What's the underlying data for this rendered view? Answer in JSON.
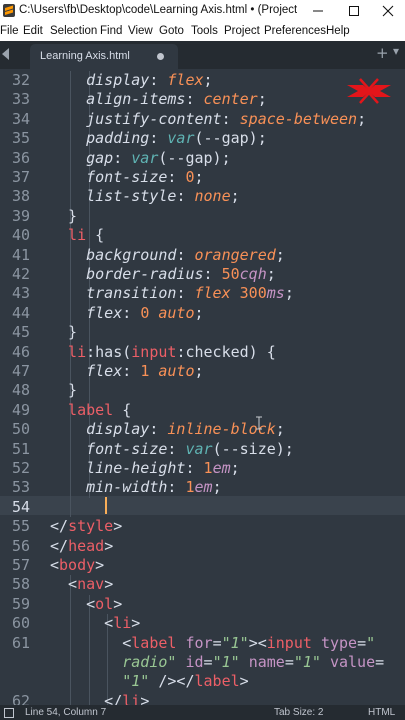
{
  "window": {
    "title": "C:\\Users\\fb\\Desktop\\code\\Learning Axis.html • (Project) - Su…",
    "controls": {
      "minimize": "minimize-icon",
      "maximize": "maximize-icon",
      "close": "close-icon"
    }
  },
  "menu": [
    "File",
    "Edit",
    "Selection",
    "Find",
    "View",
    "Goto",
    "Tools",
    "Project",
    "Preferences",
    "Help"
  ],
  "tabs": [
    {
      "label": "Learning Axis.html",
      "modified": true,
      "active": true
    }
  ],
  "editor": {
    "cursor_line": 54,
    "lines": [
      {
        "n": "32",
        "tokens": [
          {
            "t": "    display",
            "c": "prop"
          },
          {
            "t": ": ",
            "c": "pun"
          },
          {
            "t": "flex",
            "c": "val"
          },
          {
            "t": ";",
            "c": "pun"
          }
        ]
      },
      {
        "n": "33",
        "tokens": [
          {
            "t": "    align-items",
            "c": "prop"
          },
          {
            "t": ": ",
            "c": "pun"
          },
          {
            "t": "center",
            "c": "val"
          },
          {
            "t": ";",
            "c": "pun"
          }
        ]
      },
      {
        "n": "34",
        "tokens": [
          {
            "t": "    justify-content",
            "c": "prop"
          },
          {
            "t": ": ",
            "c": "pun"
          },
          {
            "t": "space-between",
            "c": "val"
          },
          {
            "t": ";",
            "c": "pun"
          }
        ]
      },
      {
        "n": "35",
        "tokens": [
          {
            "t": "    padding",
            "c": "prop"
          },
          {
            "t": ": ",
            "c": "pun"
          },
          {
            "t": "var",
            "c": "fn"
          },
          {
            "t": "(--gap);",
            "c": "pun"
          }
        ]
      },
      {
        "n": "36",
        "tokens": [
          {
            "t": "    gap",
            "c": "prop"
          },
          {
            "t": ": ",
            "c": "pun"
          },
          {
            "t": "var",
            "c": "fn"
          },
          {
            "t": "(--gap);",
            "c": "pun"
          }
        ]
      },
      {
        "n": "37",
        "tokens": [
          {
            "t": "    font-size",
            "c": "prop"
          },
          {
            "t": ": ",
            "c": "pun"
          },
          {
            "t": "0",
            "c": "num"
          },
          {
            "t": ";",
            "c": "pun"
          }
        ]
      },
      {
        "n": "38",
        "tokens": [
          {
            "t": "    list-style",
            "c": "prop"
          },
          {
            "t": ": ",
            "c": "pun"
          },
          {
            "t": "none",
            "c": "val"
          },
          {
            "t": ";",
            "c": "pun"
          }
        ]
      },
      {
        "n": "39",
        "tokens": [
          {
            "t": "  }",
            "c": "pun"
          }
        ]
      },
      {
        "n": "40",
        "tokens": [
          {
            "t": "  li",
            "c": "tag"
          },
          {
            "t": " {",
            "c": "pun"
          }
        ]
      },
      {
        "n": "41",
        "tokens": [
          {
            "t": "    background",
            "c": "prop"
          },
          {
            "t": ": ",
            "c": "pun"
          },
          {
            "t": "orangered",
            "c": "val"
          },
          {
            "t": ";",
            "c": "pun"
          }
        ]
      },
      {
        "n": "42",
        "tokens": [
          {
            "t": "    border-radius",
            "c": "prop"
          },
          {
            "t": ": ",
            "c": "pun"
          },
          {
            "t": "50",
            "c": "num"
          },
          {
            "t": "cqh",
            "c": "unit"
          },
          {
            "t": ";",
            "c": "pun"
          }
        ]
      },
      {
        "n": "43",
        "tokens": [
          {
            "t": "    transition",
            "c": "prop"
          },
          {
            "t": ": ",
            "c": "pun"
          },
          {
            "t": "flex",
            "c": "val"
          },
          {
            "t": " ",
            "c": "pun"
          },
          {
            "t": "300",
            "c": "num"
          },
          {
            "t": "ms",
            "c": "unit"
          },
          {
            "t": ";",
            "c": "pun"
          }
        ]
      },
      {
        "n": "44",
        "tokens": [
          {
            "t": "    flex",
            "c": "prop"
          },
          {
            "t": ": ",
            "c": "pun"
          },
          {
            "t": "0",
            "c": "num"
          },
          {
            "t": " ",
            "c": "pun"
          },
          {
            "t": "auto",
            "c": "val"
          },
          {
            "t": ";",
            "c": "pun"
          }
        ]
      },
      {
        "n": "45",
        "tokens": [
          {
            "t": "  }",
            "c": "pun"
          }
        ]
      },
      {
        "n": "46",
        "tokens": [
          {
            "t": "  li",
            "c": "tag"
          },
          {
            "t": ":has(",
            "c": "pun"
          },
          {
            "t": "input",
            "c": "tag"
          },
          {
            "t": ":checked) {",
            "c": "pun"
          }
        ]
      },
      {
        "n": "47",
        "tokens": [
          {
            "t": "    flex",
            "c": "prop"
          },
          {
            "t": ": ",
            "c": "pun"
          },
          {
            "t": "1",
            "c": "num"
          },
          {
            "t": " ",
            "c": "pun"
          },
          {
            "t": "auto",
            "c": "val"
          },
          {
            "t": ";",
            "c": "pun"
          }
        ]
      },
      {
        "n": "48",
        "tokens": [
          {
            "t": "  }",
            "c": "pun"
          }
        ]
      },
      {
        "n": "49",
        "tokens": [
          {
            "t": "  label",
            "c": "tag"
          },
          {
            "t": " {",
            "c": "pun"
          }
        ]
      },
      {
        "n": "50",
        "tokens": [
          {
            "t": "    display",
            "c": "prop"
          },
          {
            "t": ": ",
            "c": "pun"
          },
          {
            "t": "inline-block",
            "c": "val"
          },
          {
            "t": ";",
            "c": "pun"
          }
        ]
      },
      {
        "n": "51",
        "tokens": [
          {
            "t": "    font-size",
            "c": "prop"
          },
          {
            "t": ": ",
            "c": "pun"
          },
          {
            "t": "var",
            "c": "fn"
          },
          {
            "t": "(--size);",
            "c": "pun"
          }
        ]
      },
      {
        "n": "52",
        "tokens": [
          {
            "t": "    line-height",
            "c": "prop"
          },
          {
            "t": ": ",
            "c": "pun"
          },
          {
            "t": "1",
            "c": "num"
          },
          {
            "t": "em",
            "c": "unit"
          },
          {
            "t": ";",
            "c": "pun"
          }
        ]
      },
      {
        "n": "53",
        "tokens": [
          {
            "t": "    min-width",
            "c": "prop"
          },
          {
            "t": ": ",
            "c": "pun"
          },
          {
            "t": "1",
            "c": "num"
          },
          {
            "t": "em",
            "c": "unit"
          },
          {
            "t": ";",
            "c": "pun"
          }
        ]
      },
      {
        "n": "54",
        "tokens": [
          {
            "t": "    ",
            "c": "pun"
          }
        ]
      },
      {
        "n": "55",
        "tokens": [
          {
            "t": "</",
            "c": "pun"
          },
          {
            "t": "style",
            "c": "tag"
          },
          {
            "t": ">",
            "c": "pun"
          }
        ]
      },
      {
        "n": "56",
        "tokens": [
          {
            "t": "</",
            "c": "pun"
          },
          {
            "t": "head",
            "c": "tag"
          },
          {
            "t": ">",
            "c": "pun"
          }
        ]
      },
      {
        "n": "57",
        "tokens": [
          {
            "t": "<",
            "c": "pun"
          },
          {
            "t": "body",
            "c": "tag"
          },
          {
            "t": ">",
            "c": "pun"
          }
        ]
      },
      {
        "n": "58",
        "tokens": [
          {
            "t": "  <",
            "c": "pun"
          },
          {
            "t": "nav",
            "c": "tag"
          },
          {
            "t": ">",
            "c": "pun"
          }
        ]
      },
      {
        "n": "59",
        "tokens": [
          {
            "t": "    <",
            "c": "pun"
          },
          {
            "t": "ol",
            "c": "tag"
          },
          {
            "t": ">",
            "c": "pun"
          }
        ]
      },
      {
        "n": "60",
        "tokens": [
          {
            "t": "      <",
            "c": "pun"
          },
          {
            "t": "li",
            "c": "tag"
          },
          {
            "t": ">",
            "c": "pun"
          }
        ]
      },
      {
        "n": "61",
        "tokens": [
          {
            "t": "        <",
            "c": "pun"
          },
          {
            "t": "label",
            "c": "tag"
          },
          {
            "t": " ",
            "c": "pun"
          },
          {
            "t": "for",
            "c": "attr"
          },
          {
            "t": "=",
            "c": "pun"
          },
          {
            "t": "\"1\"",
            "c": "str"
          },
          {
            "t": "><",
            "c": "pun"
          },
          {
            "t": "input",
            "c": "tag"
          },
          {
            "t": " ",
            "c": "pun"
          },
          {
            "t": "type",
            "c": "attr"
          },
          {
            "t": "=",
            "c": "pun"
          },
          {
            "t": "\"",
            "c": "str"
          }
        ]
      },
      {
        "n": "",
        "tokens": [
          {
            "t": "        ",
            "c": "pun"
          },
          {
            "t": "radio\"",
            "c": "str"
          },
          {
            "t": " ",
            "c": "pun"
          },
          {
            "t": "id",
            "c": "attr"
          },
          {
            "t": "=",
            "c": "pun"
          },
          {
            "t": "\"1\"",
            "c": "str"
          },
          {
            "t": " ",
            "c": "pun"
          },
          {
            "t": "name",
            "c": "attr"
          },
          {
            "t": "=",
            "c": "pun"
          },
          {
            "t": "\"1\"",
            "c": "str"
          },
          {
            "t": " ",
            "c": "pun"
          },
          {
            "t": "value",
            "c": "attr"
          },
          {
            "t": "=",
            "c": "pun"
          }
        ]
      },
      {
        "n": "",
        "tokens": [
          {
            "t": "        ",
            "c": "pun"
          },
          {
            "t": "\"1\"",
            "c": "str"
          },
          {
            "t": " /></",
            "c": "pun"
          },
          {
            "t": "label",
            "c": "tag"
          },
          {
            "t": ">",
            "c": "pun"
          }
        ]
      },
      {
        "n": "62",
        "tokens": [
          {
            "t": "      </",
            "c": "pun"
          },
          {
            "t": "li",
            "c": "tag"
          },
          {
            "t": ">",
            "c": "pun"
          }
        ]
      }
    ]
  },
  "status": {
    "position": "Line 54, Column 7",
    "tab_size": "Tab Size: 2",
    "syntax": "HTML"
  },
  "colors": {
    "background": "#303841",
    "gutter_text": "#8b95a1",
    "tag": "#ec5f67",
    "property": "#d8dee9",
    "value": "#f99157",
    "function": "#5fb3b3",
    "number": "#f99157",
    "unit": "#c594c5",
    "attribute": "#c594c5",
    "string": "#99c794",
    "punctuation": "#d8dee9",
    "caret": "#f9ae58"
  }
}
